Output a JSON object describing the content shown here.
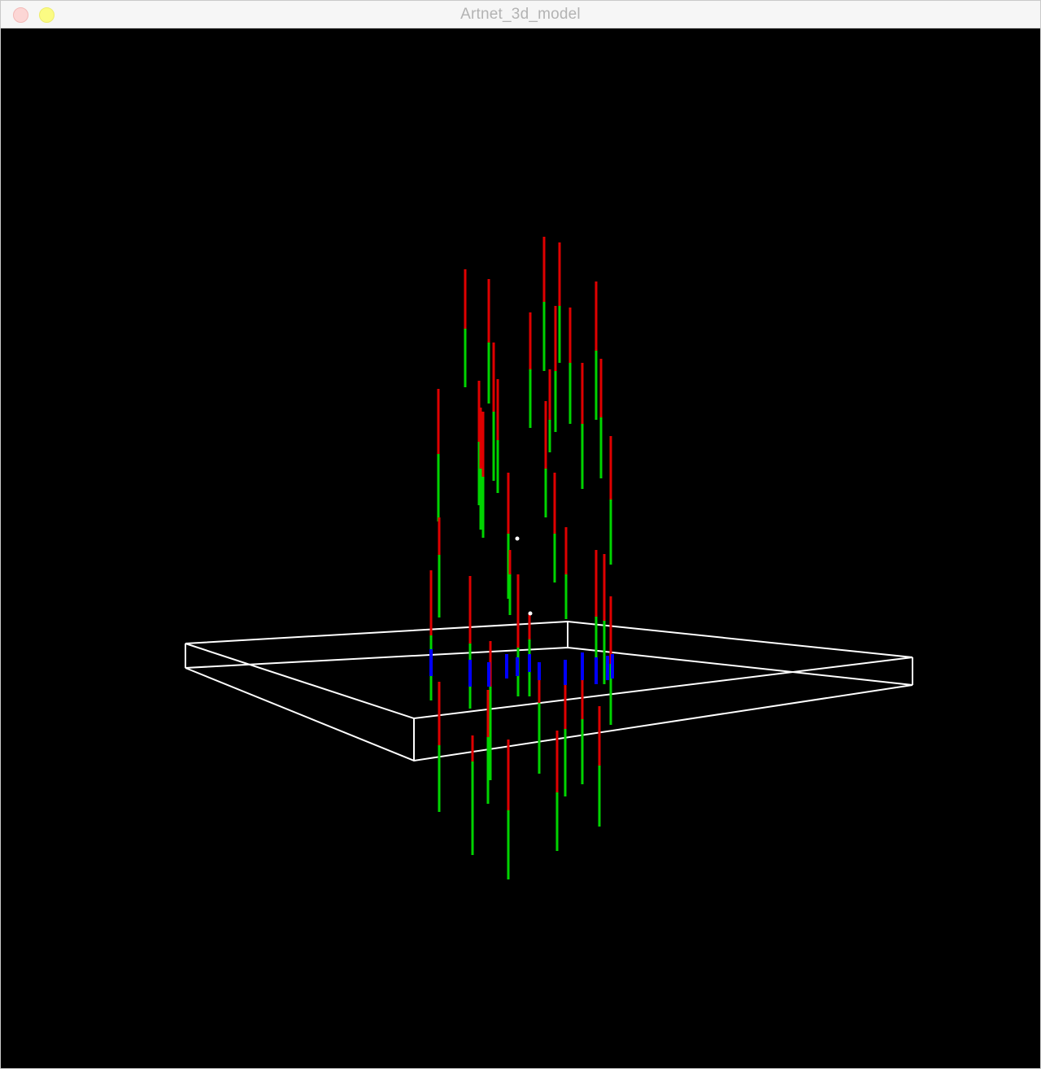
{
  "window": {
    "title": "Artnet_3d_model",
    "buttons": [
      "close",
      "minimize"
    ]
  },
  "scene": {
    "background": "#000000",
    "platform_color": "#ffffff",
    "colors": {
      "red": "#e00000",
      "green": "#00d400",
      "blue": "#0000ff",
      "white": "#ffffff"
    }
  }
}
